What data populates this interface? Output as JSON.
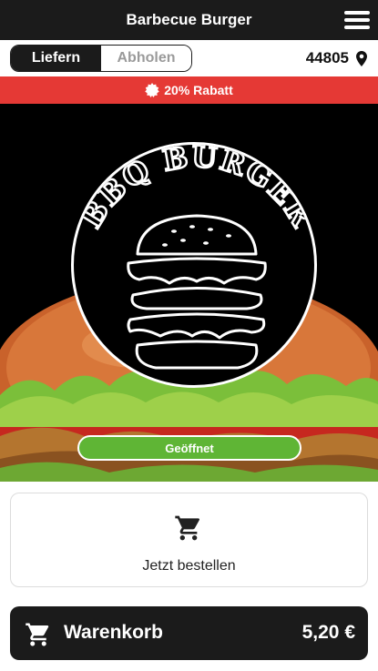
{
  "header": {
    "title": "Barbecue Burger",
    "menu_icon": "hamburger-menu-icon"
  },
  "mode_toggle": {
    "options": [
      {
        "label": "Liefern",
        "active": true
      },
      {
        "label": "Abholen",
        "active": false
      }
    ]
  },
  "location": {
    "zip": "44805",
    "icon": "map-pin-icon"
  },
  "discount_banner": {
    "text": "20% Rabatt",
    "icon": "badge-icon",
    "color": "#e53935"
  },
  "hero": {
    "logo_text": "BBQ BURGER",
    "status": "Geöffnet",
    "status_color": "#5fb535"
  },
  "order_card": {
    "label": "Jetzt bestellen",
    "icon": "cart-icon"
  },
  "cart": {
    "label": "Warenkorb",
    "price": "5,20 €",
    "icon": "cart-icon"
  },
  "colors": {
    "dark": "#1b1b1b",
    "accent_red": "#e53935",
    "open_green": "#5fb535"
  }
}
